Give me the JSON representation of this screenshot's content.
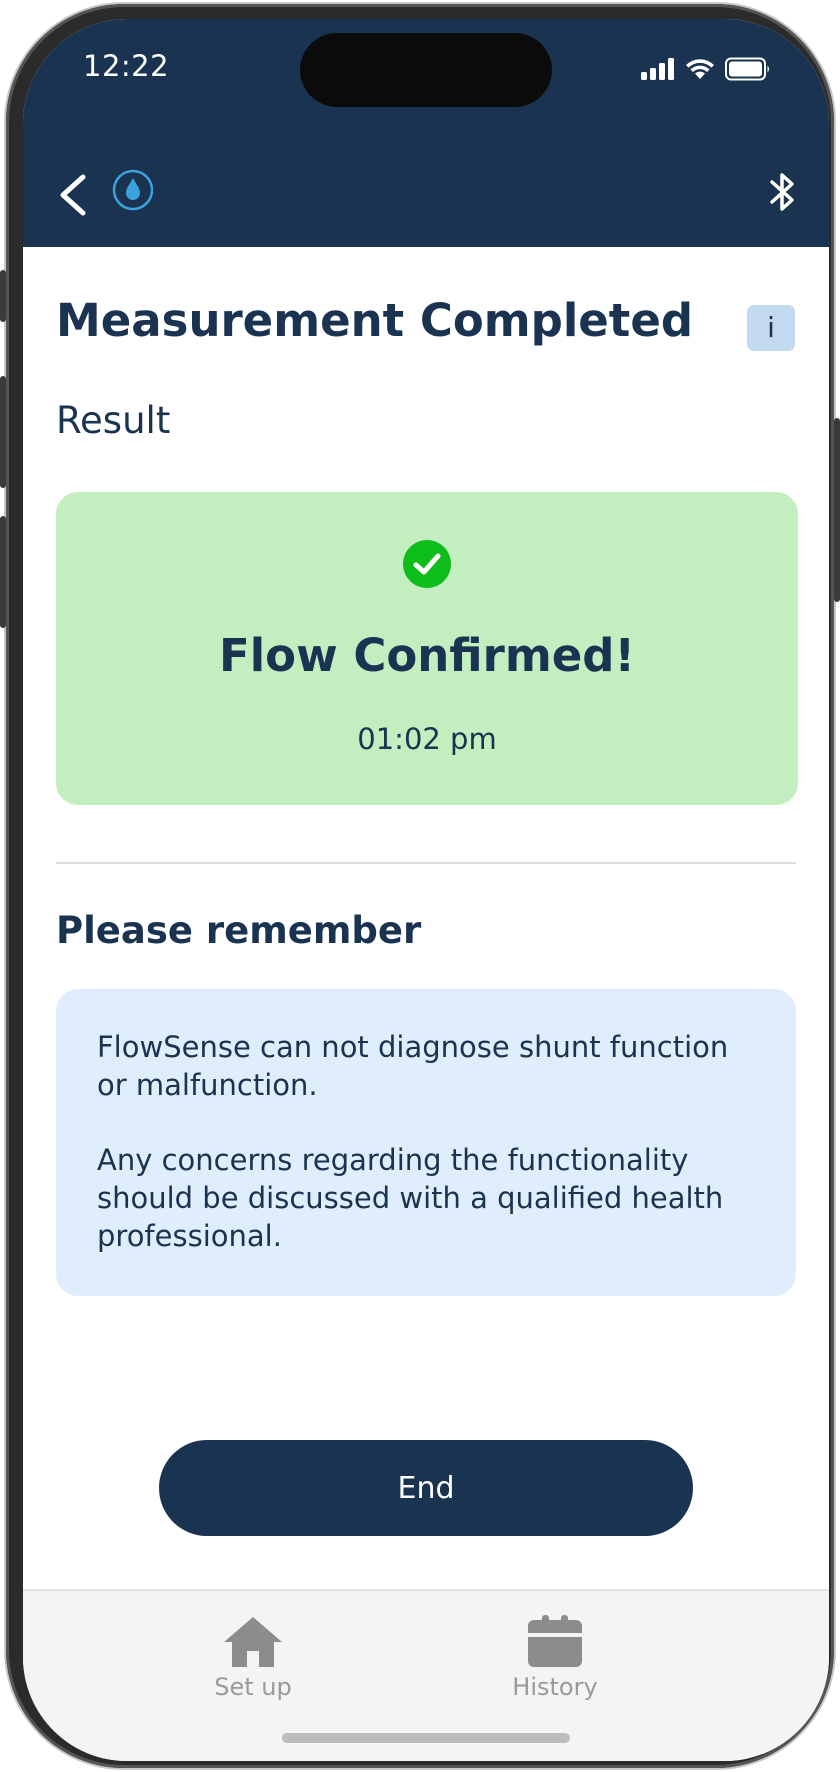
{
  "status_bar": {
    "time": "12:22"
  },
  "header": {
    "back_icon": "chevron-left-icon",
    "app_icon": "water-drop-icon",
    "bluetooth_icon": "bluetooth-icon"
  },
  "page": {
    "title": "Measurement Completed",
    "info_button_label": "i"
  },
  "result": {
    "section_label": "Result",
    "icon": "check-circle-icon",
    "status": "Flow Confirmed!",
    "time": "01:02 pm"
  },
  "reminder": {
    "title": "Please remember",
    "paragraph_1": "FlowSense can not diagnose shunt function or malfunction.",
    "paragraph_2": "Any concerns regarding the functionality should be discussed with a qualified health professional."
  },
  "actions": {
    "end_label": "End"
  },
  "tab_bar": {
    "items": [
      {
        "label": "Set up",
        "icon": "home-icon"
      },
      {
        "label": "History",
        "icon": "calendar-icon"
      }
    ]
  },
  "colors": {
    "header_bg": "#1a3350",
    "result_card_bg": "#c2eec0",
    "notice_card_bg": "#e0edfc",
    "check_green": "#0ebd1a",
    "accent_blue": "#3aa2dc"
  }
}
